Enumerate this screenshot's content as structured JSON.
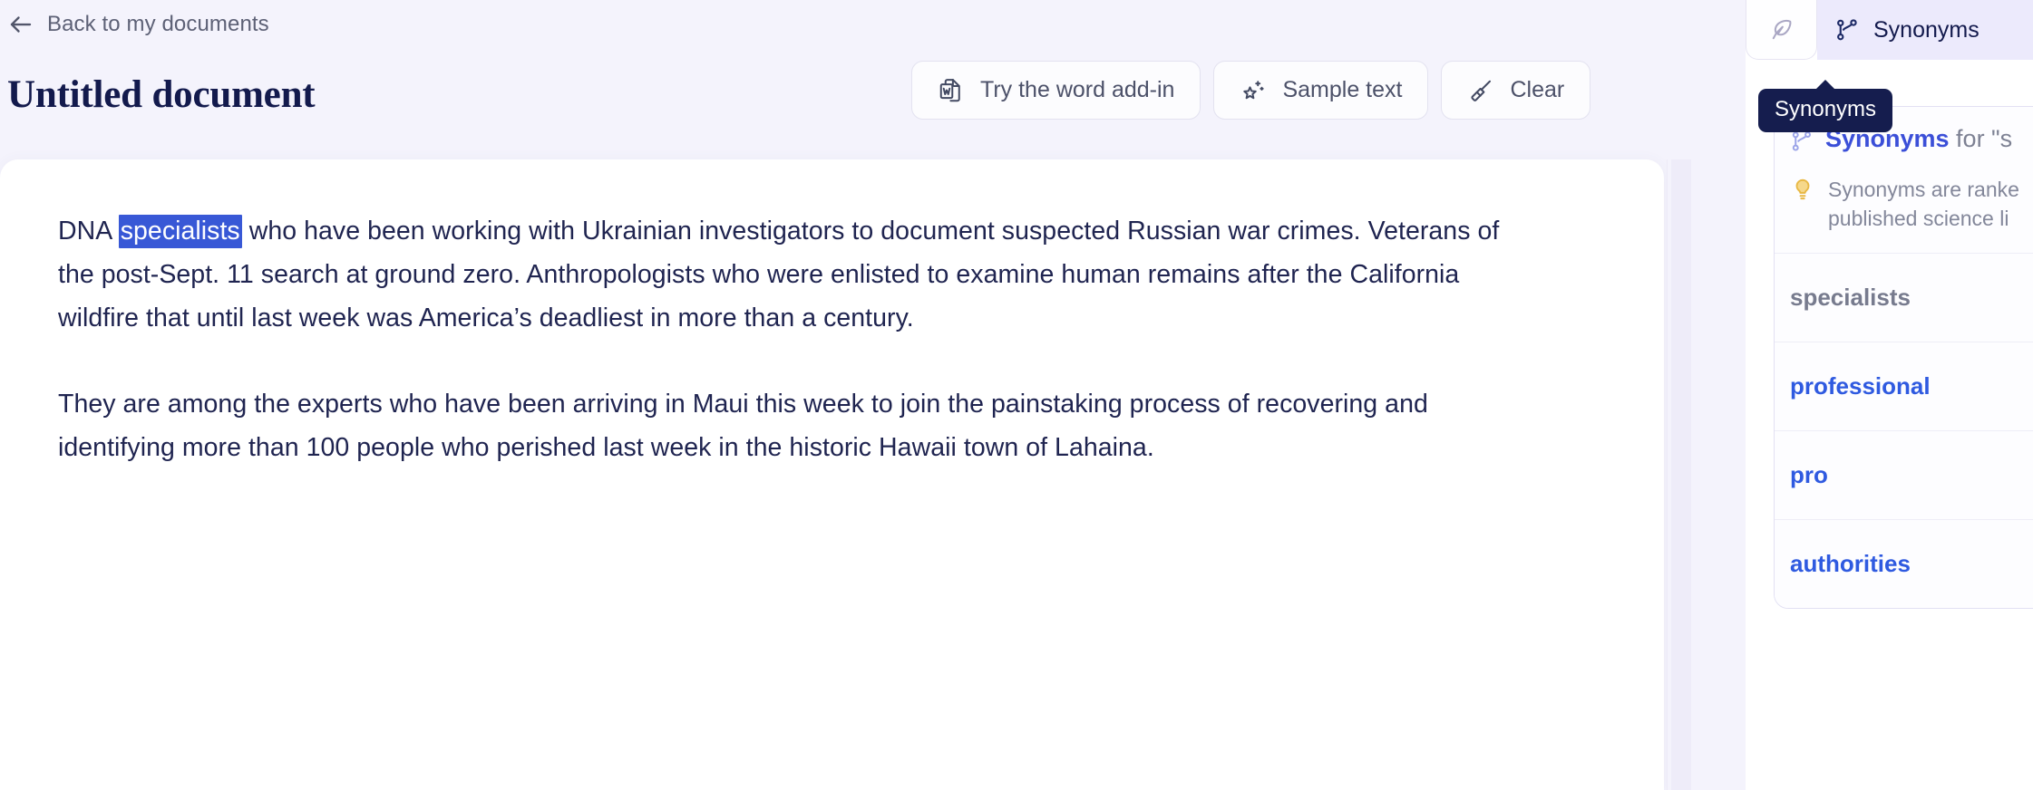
{
  "header": {
    "back_label": "Back to my documents",
    "back_icon": "arrow-left-icon",
    "doc_title": "Untitled document"
  },
  "toolbar": {
    "buttons": [
      {
        "label": "Try the word add-in",
        "icon": "word-document-icon"
      },
      {
        "label": "Sample text",
        "icon": "sparkle-star-icon"
      },
      {
        "label": "Clear",
        "icon": "broom-icon"
      }
    ]
  },
  "editor": {
    "paragraph1": {
      "before": "DNA ",
      "selected": "specialists",
      "after": " who have been working with Ukrainian investigators to document suspected Russian war crimes. Veterans of the post-Sept. 11 search at ground zero. Anthropologists who were enlisted to examine human remains after the California wildfire that until last week was America’s deadliest in more than a century."
    },
    "paragraph2": "They are among the experts who have been arriving in Maui this week to join the painstaking process of recovering and identifying more than 100 people who perished last week in the historic Hawaii town of Lahaina."
  },
  "right_panel": {
    "tabs": [
      {
        "label": "",
        "icon": "feather-icon",
        "active": false
      },
      {
        "label": "Synonyms",
        "icon": "branch-icon",
        "active": true
      }
    ],
    "tooltip": "Synonyms",
    "card": {
      "heading_highlight": "Synonyms",
      "heading_rest": " for \"s",
      "heading_icon": "branch-icon",
      "note_icon": "lightbulb-icon",
      "note_line1": "Synonyms are ranke",
      "note_line2": "published science li",
      "items": [
        {
          "label": "specialists",
          "state": "current"
        },
        {
          "label": "professional",
          "state": "alt"
        },
        {
          "label": "pro",
          "state": "alt"
        },
        {
          "label": "authorities",
          "state": "alt"
        }
      ]
    }
  },
  "colors": {
    "page_background": "#f4f3fc",
    "editor_background": "#ffffff",
    "title_navy": "#131a4d",
    "selection_blue": "#3858d6",
    "link_blue": "#2f5ae0",
    "tab_active_bg": "#eceafc",
    "tooltip_bg": "#151d4e"
  }
}
